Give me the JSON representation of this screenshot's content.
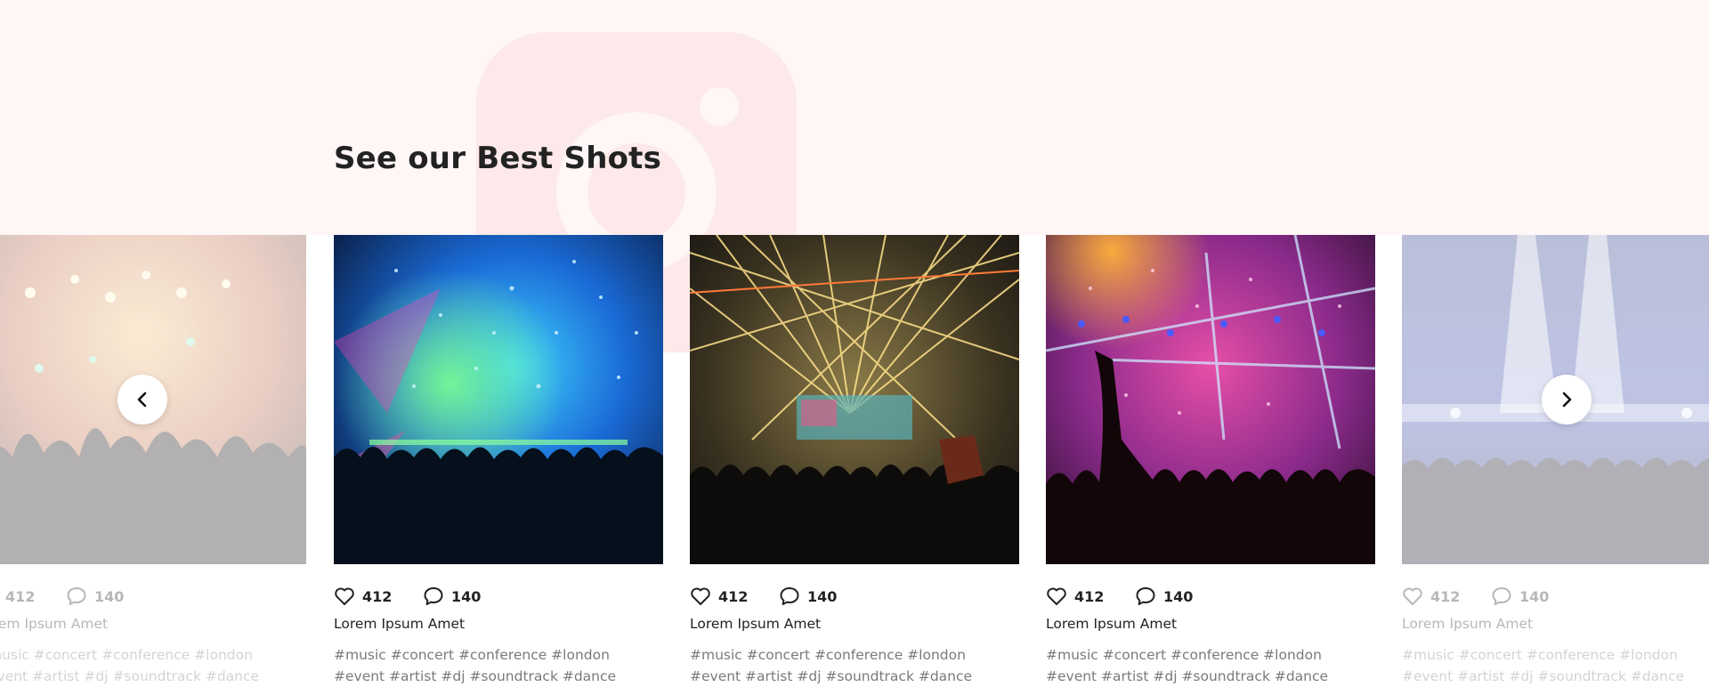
{
  "section": {
    "title": "See our Best Shots",
    "background_icon": "instagram-icon",
    "band_color": "#fff6f6"
  },
  "carousel": {
    "prev_icon": "chevron-left-icon",
    "next_icon": "chevron-right-icon",
    "cards": [
      {
        "state": "faded",
        "likes": "412",
        "comments": "140",
        "title": "Lorem Ipsum Amet",
        "tags": "#music #concert #conference #london #event #artist #dj #soundtrack #dance",
        "photo": "warm stage lights over crowd"
      },
      {
        "state": "active",
        "likes": "412",
        "comments": "140",
        "title": "Lorem Ipsum Amet",
        "tags": "#music #concert #conference #london #event #artist #dj #soundtrack #dance",
        "photo": "blue and green confetti concert"
      },
      {
        "state": "active",
        "likes": "412",
        "comments": "140",
        "title": "Lorem Ipsum Amet",
        "tags": "#music #concert #conference #london #event #artist #dj #soundtrack #dance",
        "photo": "gold laser show over crowd"
      },
      {
        "state": "active",
        "likes": "412",
        "comments": "140",
        "title": "Lorem Ipsum Amet",
        "tags": "#music #concert #conference #london #event #artist #dj #soundtrack #dance",
        "photo": "pink confetti festival crowd"
      },
      {
        "state": "faded",
        "likes": "412",
        "comments": "140",
        "title": "Lorem Ipsum Amet",
        "tags": "#music #concert #conference #london #event #artist #dj #soundtrack #dance",
        "photo": "blue spotlights stage band"
      }
    ]
  }
}
